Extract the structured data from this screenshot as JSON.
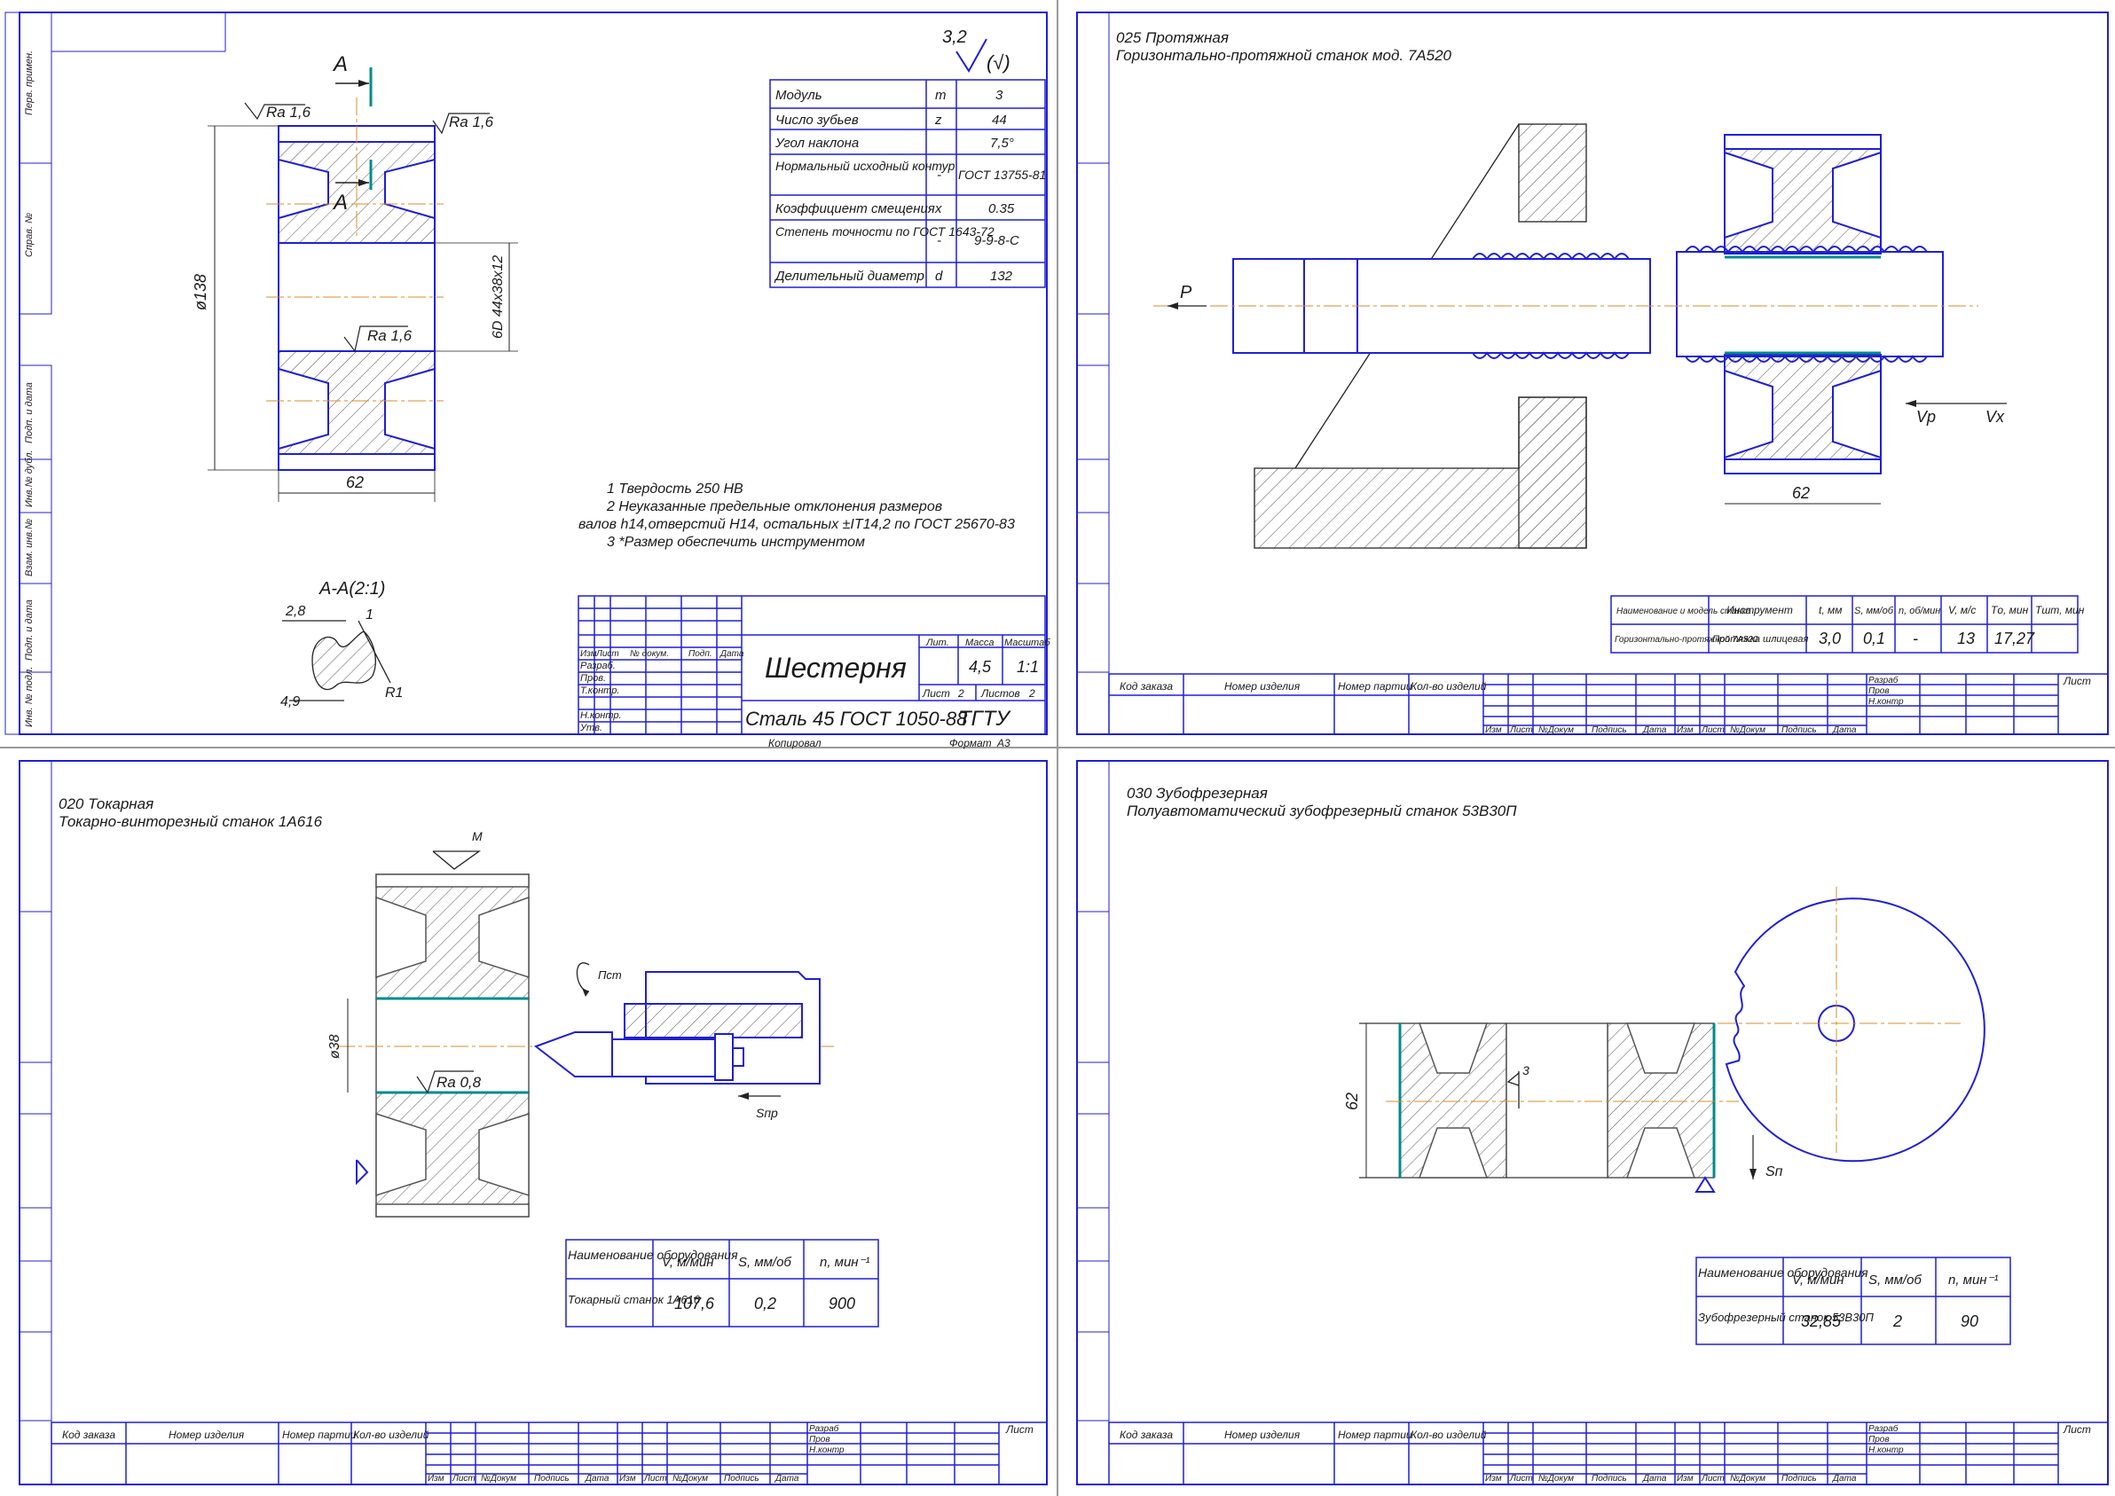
{
  "sheet1": {
    "title": "Шестерня",
    "material": "Сталь 45 ГОСТ 1050-88",
    "org": "ТГТУ",
    "roughness_general": "3,2",
    "roughness_mark": "(√)",
    "section_top": "A",
    "section_bottom": "A",
    "section_view": "A-A(2:1)",
    "ra_left": "Ra 1,6",
    "ra_right": "Ra 1,6",
    "ra_bore": "Ra 1,6",
    "dim_diameter": "ø138",
    "dim_width": "62",
    "dim_spline": "6D 44x38x12",
    "detail_28": "2,8",
    "detail_1": "1",
    "detail_49": "4,9",
    "detail_r1": "R1",
    "notes": [
      "1 Твердость 250 HB",
      "2 Неуказанные предельные отклонения размеров",
      "валов h14,отверстий H14, остальных ±IT14,2 по ГОСТ 25670-83",
      "3 *Размер обеспечить инструментом"
    ],
    "params": [
      {
        "name": "Модуль",
        "sym": "m",
        "val": "3"
      },
      {
        "name": "Число зубьев",
        "sym": "z",
        "val": "44"
      },
      {
        "name": "Угол наклона",
        "sym": "",
        "val": "7,5°"
      },
      {
        "name": "Нормальный исходный контур",
        "sym": "-",
        "val": "ГОСТ 13755-81"
      },
      {
        "name": "Коэффициент смещения",
        "sym": "x",
        "val": "0.35"
      },
      {
        "name": "Степень точности по ГОСТ 1643-72",
        "sym": "-",
        "val": "9-9-8-С"
      },
      {
        "name": "Делительный диаметр",
        "sym": "d",
        "val": "132"
      }
    ],
    "tb": {
      "izm": "Изм",
      "list": "Лист",
      "ndoc": "№ докум.",
      "podp": "Подп.",
      "data": "Дата",
      "razrab": "Разраб.",
      "prov": "Пров.",
      "tkontr": "Т.контр.",
      "nkontr": "Н.контр.",
      "utv": "Утв.",
      "lit": "Лит.",
      "massa": "Масса",
      "masshtab": "Масштаб",
      "mass_val": "4,5",
      "scale_val": "1:1",
      "sheet_label": "Лист",
      "sheet_num": "2",
      "sheets_label": "Листов",
      "sheets_num": "2",
      "kopiroval": "Копировал",
      "format": "Формат",
      "format_val": "А3"
    }
  },
  "side_labels": [
    "Перв. примен.",
    "Справ. №",
    "Подп. и дата",
    "Инв.№ дубл.",
    "Взам. инв.№",
    "Подп. и дата",
    "Инв. № подл."
  ],
  "sheet2": {
    "op": "025 Протяжная",
    "machine": "Горизонтально-протяжной станок мод. 7А520",
    "force_label": "P",
    "vp": "Vp",
    "vx": "Vx",
    "dim": "62",
    "table": {
      "headers": [
        "Наименование и модель станка",
        "Инструмент",
        "t, мм",
        "S, мм/об",
        "n, об/мин",
        "V, м/с",
        "Tо, мин",
        "Tшт, мин"
      ],
      "row": [
        "Горизонтально-протяжной 7А520",
        "Протяжка шлицевая",
        "3,0",
        "0,1",
        "-",
        "13",
        "17,27",
        ""
      ]
    }
  },
  "sheet3": {
    "op": "020 Токарная",
    "machine": "Токарно-винторезный станок 1А616",
    "m": "M",
    "dim": "ø38",
    "ra": "Ra 0,8",
    "n": "Пст",
    "s": "Sпр",
    "table": {
      "headers": [
        "Наименование оборудования",
        "V, м/мин",
        "S, мм/об",
        "n, мин⁻¹"
      ],
      "row": [
        "Токарный станок 1А616",
        "107,6",
        "0,2",
        "900"
      ]
    }
  },
  "sheet4": {
    "op": "030 Зубофрезерная",
    "machine": "Полуавтоматический зубофрезерный станок 53В30П",
    "dim": "62",
    "n3": "3",
    "s": "Sп",
    "table": {
      "headers": [
        "Наименование оборудования",
        "V, м/мин",
        "S, мм/об",
        "n, мин⁻¹"
      ],
      "row": [
        "Зубофрезерный станок 53В30П",
        "32,85",
        "2",
        "90"
      ]
    }
  },
  "stamp": {
    "kod": "Код заказа",
    "nomer": "Номер изделия",
    "partia": "Номер партии",
    "kol": "Кол-во изделий",
    "list": "Лист",
    "razrab": "Разраб",
    "prov": "Пров",
    "nkontr": "Н.контр",
    "cols": [
      "Изм",
      "Лист",
      "№Докум",
      "Подпись",
      "Дата",
      "Изм",
      "Лист",
      "№Докум",
      "Подпись",
      "Дата"
    ]
  },
  "colors": {
    "frame": "#1f1fd6",
    "line": "#222222",
    "center": "#d98c2b",
    "teal": "#008b8b"
  }
}
